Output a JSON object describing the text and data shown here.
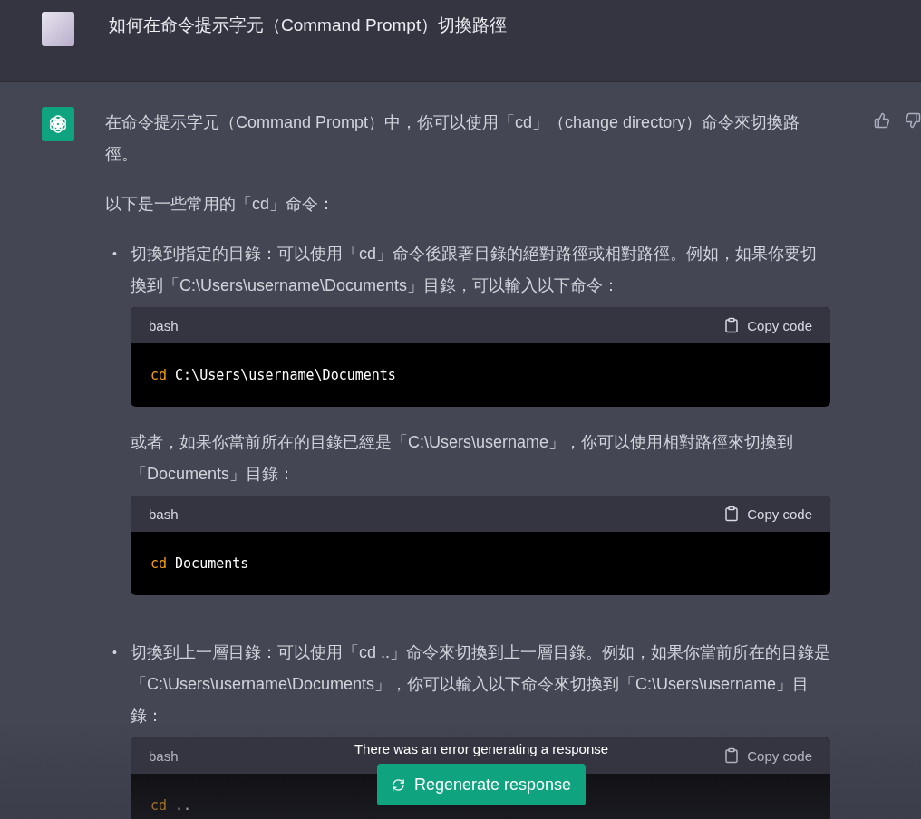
{
  "question": {
    "text": "如何在命令提示字元（Command Prompt）切換路徑"
  },
  "answer": {
    "paragraphs": [
      "在命令提示字元（Command Prompt）中，你可以使用「cd」（change directory）命令來切換路徑。",
      "以下是一些常用的「cd」命令："
    ],
    "items": [
      {
        "marker": "•",
        "parts": [
          {
            "kind": "paragraph",
            "text": "切換到指定的目錄：可以使用「cd」命令後跟著目錄的絕對路徑或相對路徑。例如，如果你要切換到「C:\\Users\\username\\Documents」目錄，可以輸入以下命令："
          },
          {
            "kind": "code",
            "language": "bash",
            "copy_label": "Copy code",
            "tokens": [
              {
                "kind": "keyword",
                "text": "cd"
              },
              {
                "kind": "plain",
                "text": "C:\\Users\\username\\Documents"
              }
            ]
          },
          {
            "kind": "paragraph",
            "text": "或者，如果你當前所在的目錄已經是「C:\\Users\\username」，你可以使用相對路徑來切換到「Documents」目錄："
          },
          {
            "kind": "code",
            "language": "bash",
            "copy_label": "Copy code",
            "tokens": [
              {
                "kind": "keyword",
                "text": "cd"
              },
              {
                "kind": "plain",
                "text": "Documents"
              }
            ]
          }
        ]
      },
      {
        "marker": "•",
        "parts": [
          {
            "kind": "paragraph",
            "text": "切換到上一層目錄：可以使用「cd ..」命令來切換到上一層目錄。例如，如果你當前所在的目錄是「C:\\Users\\username\\Documents」，你可以輸入以下命令來切換到「C:\\Users\\username」目錄："
          },
          {
            "kind": "code",
            "language": "bash",
            "copy_label": "Copy code",
            "tokens": [
              {
                "kind": "keyword",
                "text": "cd"
              },
              {
                "kind": "plain",
                "text": ".."
              }
            ]
          }
        ]
      }
    ]
  },
  "footer": {
    "error": "There was an error generating a response",
    "button": "Regenerate response"
  }
}
